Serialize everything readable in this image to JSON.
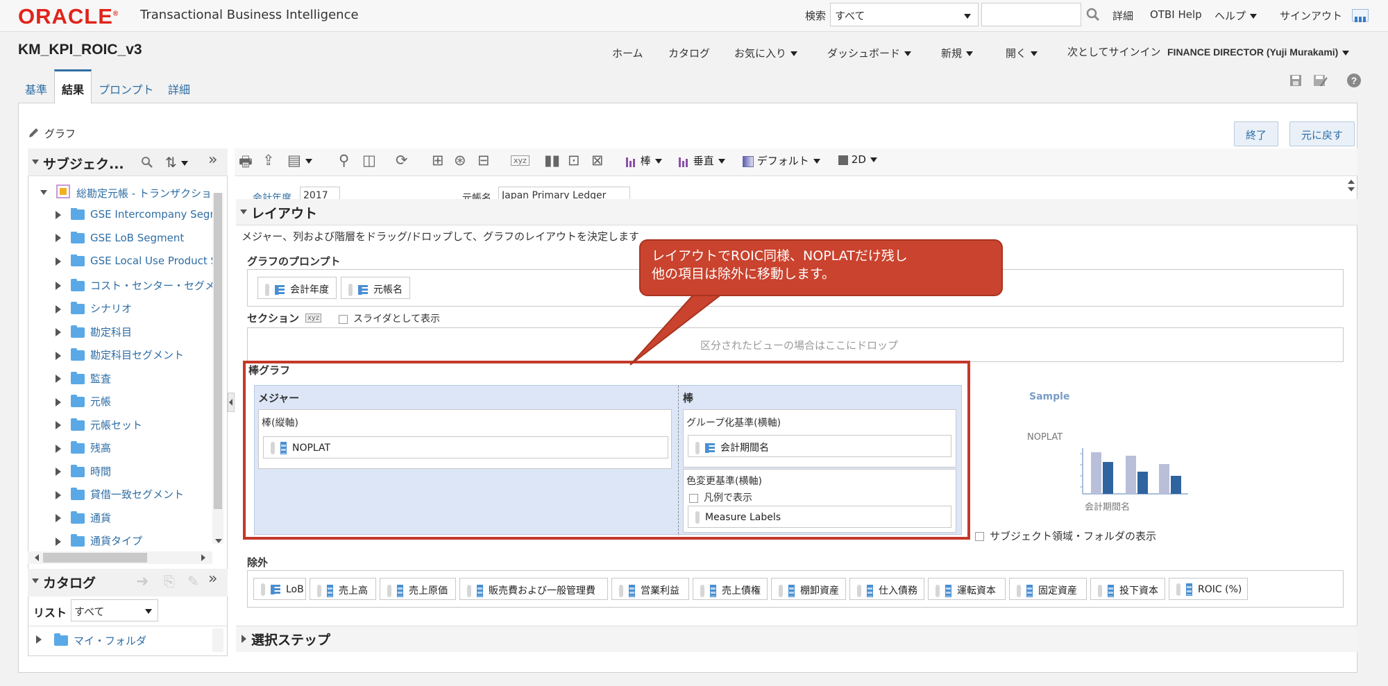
{
  "header": {
    "brand": "ORACLE",
    "product": "Transactional Business Intelligence",
    "search_label": "検索",
    "search_scope": "すべて",
    "search_value": "",
    "links": [
      "詳細",
      "OTBI Help",
      "ヘルプ",
      "サインアウト"
    ]
  },
  "titlebar": {
    "title": "KM_KPI_ROIC_v3",
    "nav": [
      "ホーム",
      "カタログ",
      "お気に入り",
      "ダッシュボード",
      "新規",
      "開く"
    ],
    "signin_label": "次としてサインイン",
    "signin_user": "FINANCE DIRECTOR (Yuji Murakami)"
  },
  "tabs": [
    {
      "label": "基準",
      "active": false
    },
    {
      "label": "結果",
      "active": true
    },
    {
      "label": "プロンプト",
      "active": false
    },
    {
      "label": "詳細",
      "active": false
    }
  ],
  "editor": {
    "view_label": "グラフ",
    "done_button": "終了",
    "revert_button": "元に戻す"
  },
  "subject_area": {
    "title": "サブジェク...",
    "root": "総勘定元帳 - トランザクション",
    "items": [
      "GSE Intercompany Segme",
      "GSE LoB Segment",
      "GSE Local Use Product Se",
      "コスト・センター・セグメ",
      "シナリオ",
      "勘定科目",
      "勘定科目セグメント",
      "監査",
      "元帳",
      "元帳セット",
      "残高",
      "時間",
      "貸借一致セグメント",
      "通貨",
      "通貨タイプ"
    ]
  },
  "catalog": {
    "title": "カタログ",
    "list_label": "リスト",
    "list_value": "すべて",
    "folder": "マイ・フォルダ"
  },
  "toolbar": {
    "chart_type": "棒",
    "orientation": "垂直",
    "style": "デフォルト",
    "dimension": "2D"
  },
  "preview": {
    "prompt1_label": "会計年度",
    "prompt1_value": "2017",
    "prompt2_label": "元帳名",
    "prompt2_value": "Japan Primary Ledger"
  },
  "layout": {
    "title": "レイアウト",
    "description": "メジャー、列および階層をドラッグ/ドロップして、グラフのレイアウトを決定します",
    "graph_prompts_label": "グラフのプロンプト",
    "graph_prompts": [
      "会計年度",
      "元帳名"
    ],
    "sections_label": "セクション",
    "sections_slider_label": "スライダとして表示",
    "sections_drop_hint": "区分されたビューの場合はここにドロップ",
    "bar_chart_label": "棒グラフ",
    "measures_header": "メジャー",
    "bars_axis_label": "棒(縦軸)",
    "bars_axis_item": "NOPLAT",
    "bar_header": "棒",
    "group_by_label": "グループ化基準(横軸)",
    "group_by_item": "会計期間名",
    "vary_color_label": "色変更基準(横軸)",
    "show_in_legend_label": "凡例で表示",
    "vary_color_item": "Measure Labels",
    "show_subject_folders": "サブジェクト領域・フォルダの表示",
    "excluded_label": "除外",
    "excluded": [
      "LoB",
      "売上高",
      "売上原価",
      "販売費および一般管理費",
      "営業利益",
      "売上債権",
      "棚卸資産",
      "仕入債務",
      "運転資本",
      "固定資産",
      "投下資本",
      "ROIC (%)"
    ]
  },
  "sample_chart": {
    "title": "Sample",
    "ylabel": "NOPLAT",
    "xlabel": "会計期間名"
  },
  "callout": {
    "line1": "レイアウトでROIC同様、NOPLATだけ残し",
    "line2": "他の項目は除外に移動します。"
  },
  "selection_steps": {
    "title": "選択ステップ"
  },
  "colors": {
    "oracle_red": "#e2231a",
    "link_blue": "#2e6da4",
    "callout_red": "#c9432e",
    "bar_light": "#b9bfd9",
    "bar_dark": "#2f64a0"
  }
}
